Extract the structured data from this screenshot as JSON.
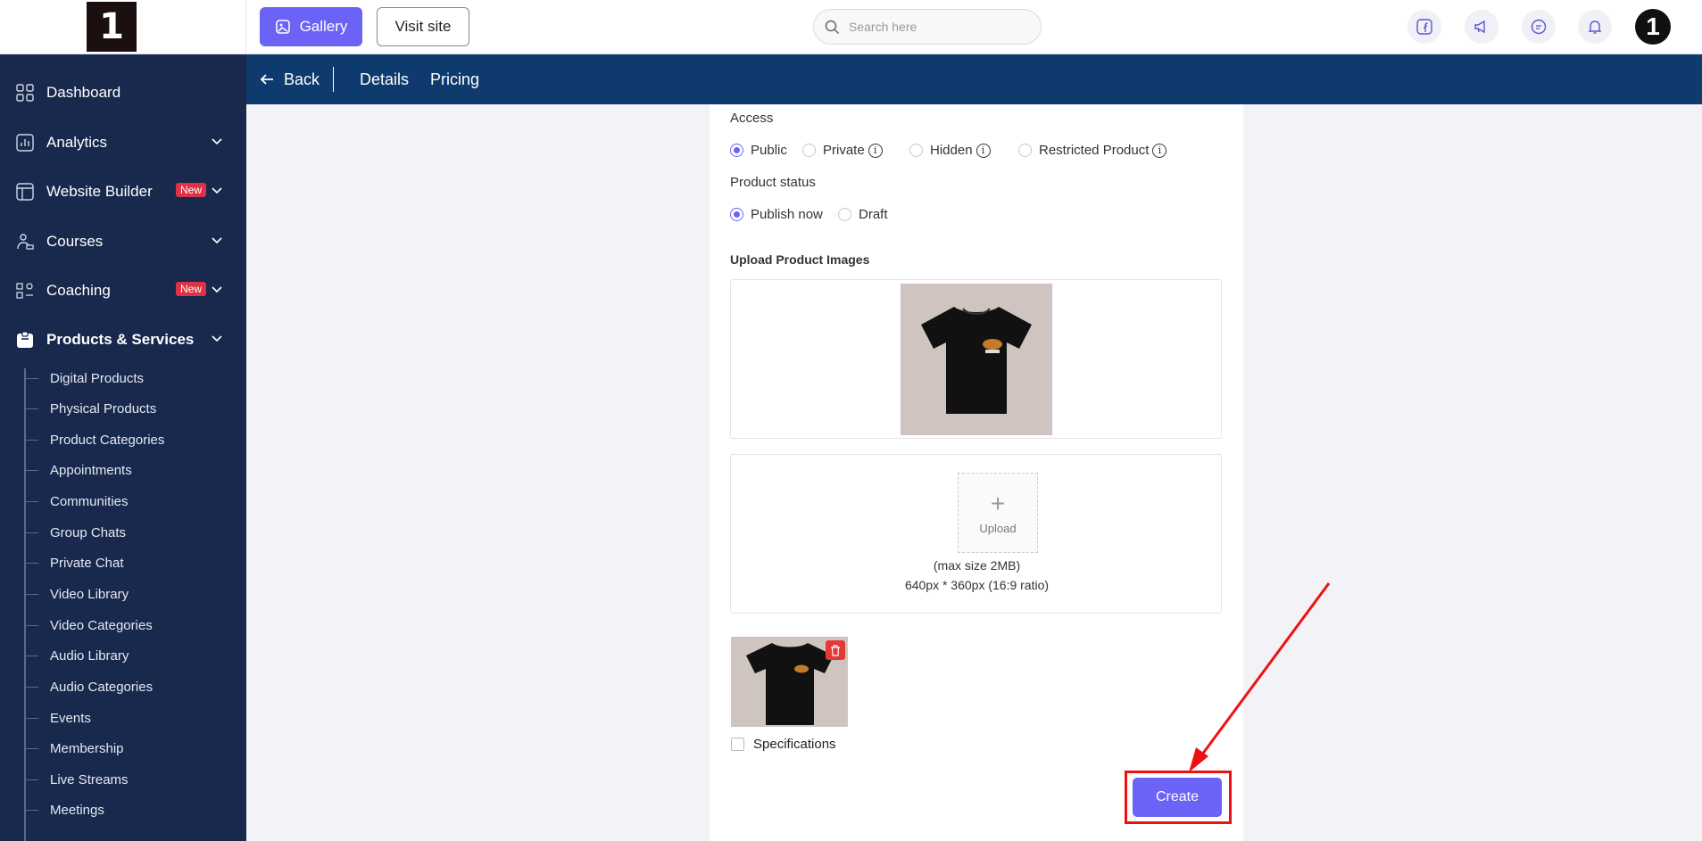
{
  "header": {
    "logo_text": "1",
    "gallery_label": "Gallery",
    "visit_site_label": "Visit site",
    "search_placeholder": "Search here",
    "avatar_text": "1"
  },
  "sidebar": {
    "items": [
      {
        "label": "Dashboard",
        "icon": "dashboard-icon"
      },
      {
        "label": "Analytics",
        "icon": "analytics-icon"
      },
      {
        "label": "Website Builder",
        "icon": "website-builder-icon",
        "badge": "New"
      },
      {
        "label": "Courses",
        "icon": "courses-icon"
      },
      {
        "label": "Coaching",
        "icon": "coaching-icon",
        "badge": "New"
      },
      {
        "label": "Products & Services",
        "icon": "products-icon"
      }
    ],
    "sub_items": [
      "Digital Products",
      "Physical Products",
      "Product Categories",
      "Appointments",
      "Communities",
      "Group Chats",
      "Private Chat",
      "Video Library",
      "Video Categories",
      "Audio Library",
      "Audio Categories",
      "Events",
      "Membership",
      "Live Streams",
      "Meetings"
    ]
  },
  "tabbar": {
    "back_label": "Back",
    "tabs": [
      "Details",
      "Pricing"
    ]
  },
  "form": {
    "access_label": "Access",
    "access_options": [
      "Public",
      "Private",
      "Hidden",
      "Restricted Product"
    ],
    "access_selected": "Public",
    "status_label": "Product status",
    "status_options": [
      "Publish now",
      "Draft"
    ],
    "status_selected": "Publish now",
    "upload_label": "Upload Product Images",
    "upload_tile_text": "Upload",
    "upload_hint_1": "(max size 2MB)",
    "upload_hint_2": "640px * 360px (16:9 ratio)",
    "specifications_label": "Specifications",
    "create_label": "Create"
  },
  "colors": {
    "accent": "#6a63f6",
    "sidebar_bg": "#18294d",
    "tabbar_bg": "#0e3a6e",
    "highlight": "#ee1111"
  }
}
